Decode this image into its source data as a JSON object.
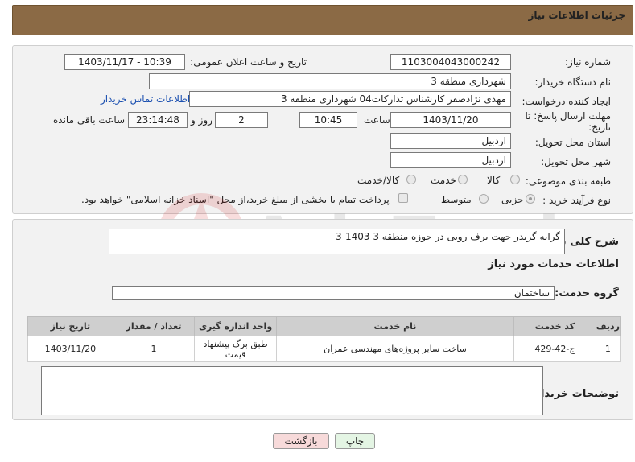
{
  "header": {
    "title": "جزئیات اطلاعات نیاز"
  },
  "form": {
    "need_number_label": "شماره نیاز:",
    "need_number": "1103004043000242",
    "announce_label": "تاریخ و ساعت اعلان عمومی:",
    "announce_value": "1403/11/17 - 10:39",
    "buyer_org_label": "نام دستگاه خریدار:",
    "buyer_org": "شهرداری منطقه 3",
    "creator_label": "ایجاد کننده درخواست:",
    "creator": "مهدی نژادصفر کارشناس تدارکات04 شهرداری منطقه 3",
    "contact_link": "اطلاعات تماس خریدار",
    "deadline_label_1": "مهلت ارسال پاسخ: تا",
    "deadline_label_2": "تاریخ:",
    "deadline_date": "1403/11/20",
    "time_label": "ساعت",
    "deadline_time": "10:45",
    "days_value": "2",
    "days_label": "روز و",
    "remaining_value": "23:14:48",
    "remaining_label": "ساعت باقی مانده",
    "province_label": "استان محل تحویل:",
    "province": "اردبیل",
    "city_label": "شهر محل تحویل:",
    "city": "اردبیل",
    "category_label": "طبقه بندی موضوعی:",
    "category_options": [
      "کالا",
      "خدمت",
      "کالا/خدمت"
    ],
    "process_label": "نوع فرآیند خرید :",
    "process_options": [
      "جزیی",
      "متوسط"
    ],
    "payment_note": "پرداخت تمام یا بخشی از مبلغ خرید،از محل \"اسناد خزانه اسلامی\" خواهد بود."
  },
  "summary": {
    "label": "شرح کلی نیاز:",
    "value": "گرایه گریدر جهت برف روبی در حوزه منطقه 3 1403-3"
  },
  "services": {
    "section_title": "اطلاعات خدمات مورد نیاز",
    "group_label": "گروه خدمت:",
    "group_value": "ساختمان",
    "columns": [
      "ردیف",
      "کد خدمت",
      "نام خدمت",
      "واحد اندازه گیری",
      "تعداد / مقدار",
      "تاریخ نیاز"
    ],
    "rows": [
      {
        "row": "1",
        "code": "ج-42-429",
        "name": "ساخت سایر پروژه‌های مهندسی عمران",
        "unit": "طبق برگ پیشنهاد قیمت",
        "qty": "1",
        "date": "1403/11/20"
      }
    ]
  },
  "buyer_notes": {
    "label": "توضیحات خریدار:",
    "value": ""
  },
  "buttons": {
    "print": "چاپ",
    "back": "بازگشت"
  },
  "watermark": {
    "text": "AriaTender.neT"
  },
  "colors": {
    "header": "#8b6a45",
    "back_button": "#f7dada",
    "print_button": "#e4f5e4",
    "link": "#1a4fb0"
  }
}
